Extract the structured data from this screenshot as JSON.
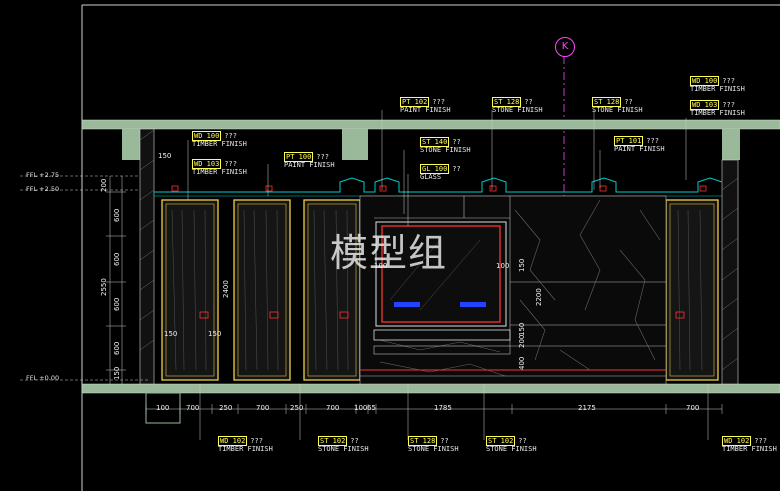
{
  "watermark": "模型组",
  "axis_marker": "K",
  "colors": {
    "background": "#000000",
    "slab": "#9ab89a",
    "tag_code": "#ffff55",
    "panel_outline": "#e0c040",
    "cyan": "#00cccc",
    "red": "#ff3030",
    "magenta": "#ff44ff",
    "text": "#e8e8e8"
  },
  "levels": [
    "FFL +2.75",
    "FFL +2.50",
    "FFL ±0.00"
  ],
  "tags_top": [
    {
      "code": "PT 102",
      "q": "???",
      "text": "PAINT FINISH"
    },
    {
      "code": "ST 128",
      "q": "??",
      "text": "STONE FINISH"
    },
    {
      "code": "ST 128",
      "q": "??",
      "text": "STONE FINISH"
    },
    {
      "code": "WD 100",
      "q": "???",
      "text": "TIMBER FINISH"
    },
    {
      "code": "WD 103",
      "q": "???",
      "text": "TIMBER FINISH"
    }
  ],
  "tags_mid": [
    {
      "code": "WD 100",
      "q": "???",
      "text": "TIMBER FINISH"
    },
    {
      "code": "WD 103",
      "q": "???",
      "text": "TIMBER FINISH"
    },
    {
      "code": "PT 100",
      "q": "???",
      "text": "PAINT FINISH"
    },
    {
      "code": "ST 140",
      "q": "??",
      "text": "STONE FINISH"
    },
    {
      "code": "GL 100",
      "q": "??",
      "text": "GLASS"
    },
    {
      "code": "PT 101",
      "q": "???",
      "text": "PAINT FINISH"
    }
  ],
  "tags_bottom": [
    {
      "code": "WD 102",
      "q": "???",
      "text": "TIMBER FINISH"
    },
    {
      "code": "ST 102",
      "q": "??",
      "text": "STONE FINISH"
    },
    {
      "code": "ST 128",
      "q": "??",
      "text": "STONE FINISH"
    },
    {
      "code": "ST 102",
      "q": "??",
      "text": "STONE FINISH"
    },
    {
      "code": "WD 102",
      "q": "???",
      "text": "TIMBER FINISH"
    }
  ],
  "bottom_dims": [
    "100",
    "700",
    "250",
    "700",
    "250",
    "700",
    "100",
    "65",
    "1785",
    "2175",
    "700"
  ],
  "left_dims": [
    "200",
    "600",
    "600",
    "600",
    "600",
    "150",
    "2550"
  ],
  "inner_dims": [
    "150",
    "2400",
    "100",
    "100",
    "150",
    "2200",
    "400",
    "200",
    "150",
    "150",
    "150"
  ]
}
